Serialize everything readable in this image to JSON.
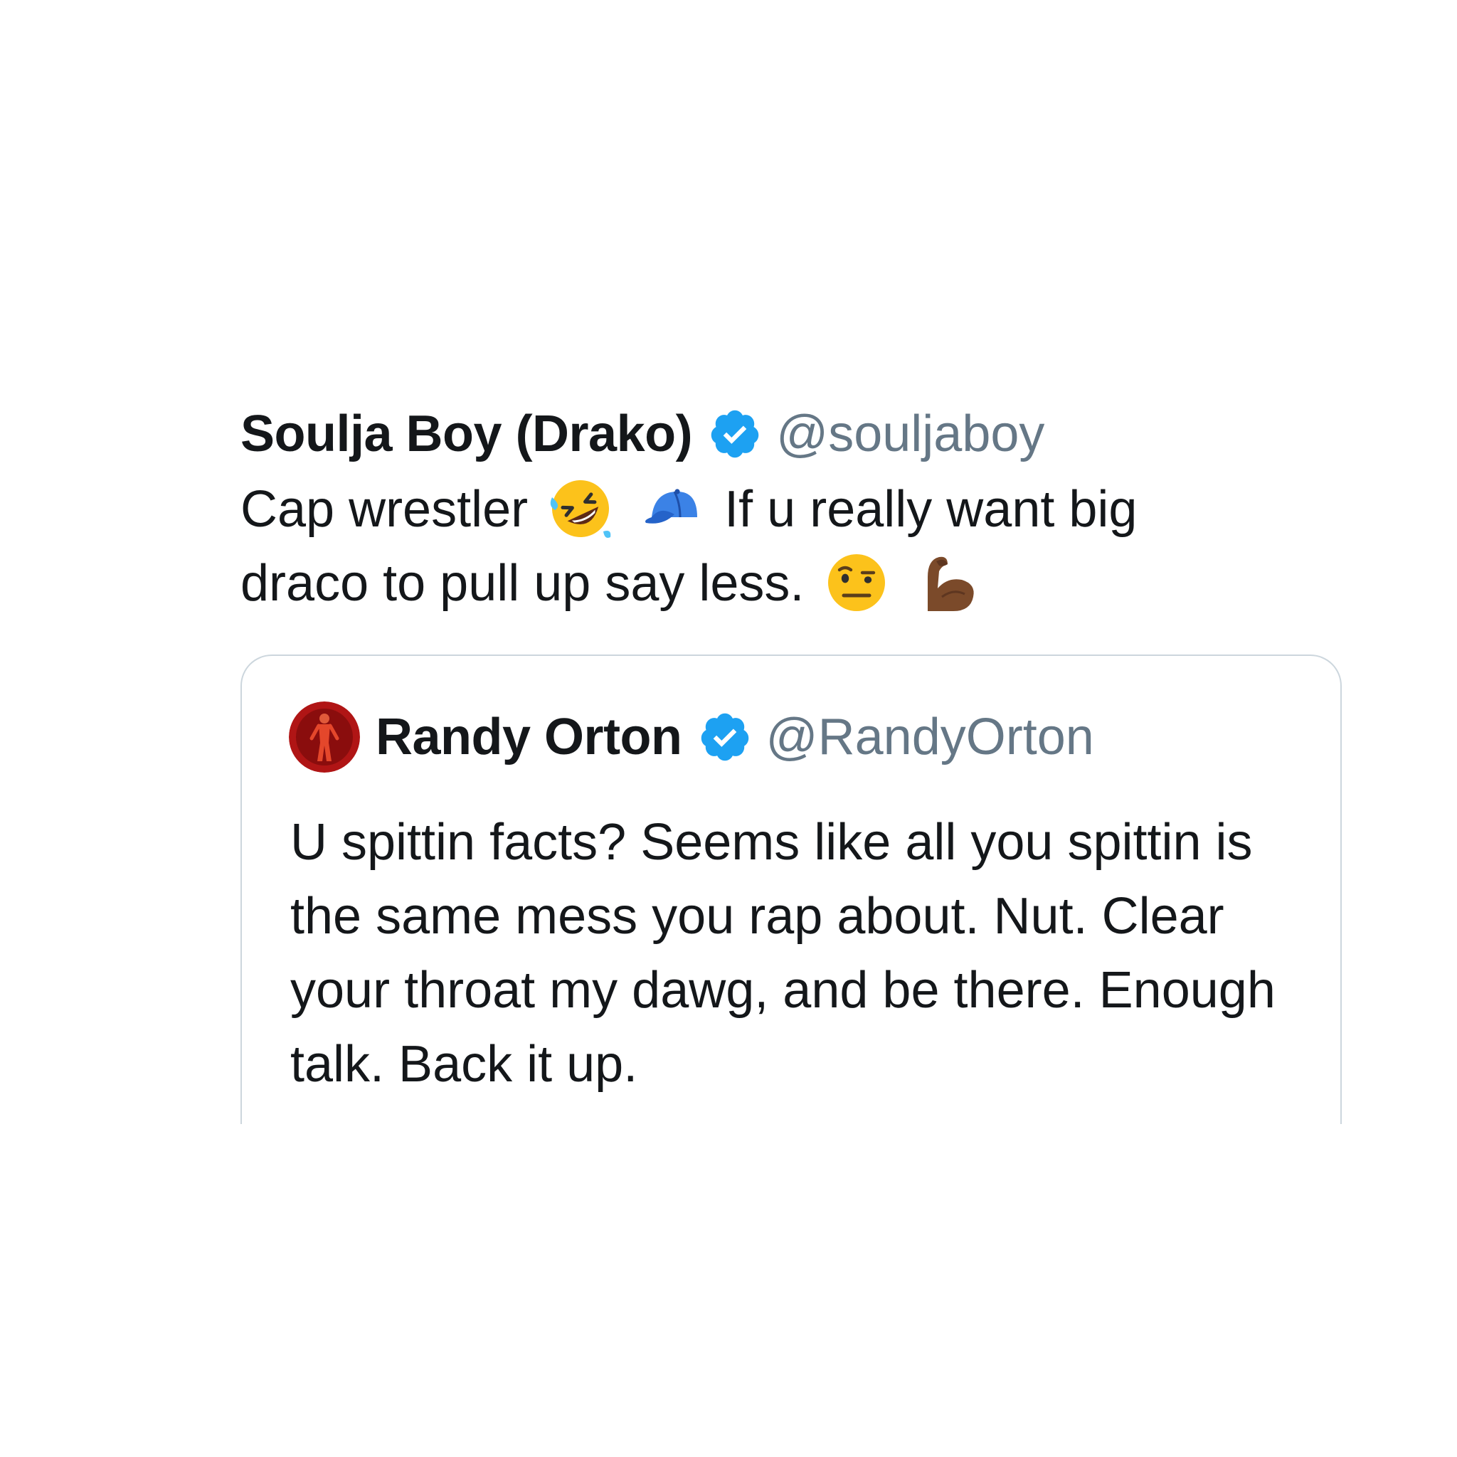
{
  "tweet": {
    "display_name": "Soulja Boy (Drako)",
    "handle": "@souljaboy",
    "text_part1": "Cap wrestler",
    "text_part2": "If u really want big draco to pull up say less.",
    "emojis": [
      "rolling-on-floor-laughing-emoji",
      "billed-cap-emoji",
      "face-with-raised-eyebrow-emoji",
      "flexed-biceps-emoji"
    ]
  },
  "quoted_tweet": {
    "display_name": "Randy Orton",
    "handle": "@RandyOrton",
    "text": "U spittin facts? Seems like all you spittin is the same mess you rap about. Nut. Clear your throat my dawg, and be there. Enough talk. Back it up."
  },
  "colors": {
    "verified_blue": "#1da1f2",
    "handle_gray": "#657786",
    "text_dark": "#14171a",
    "border": "#ccd6dd"
  }
}
